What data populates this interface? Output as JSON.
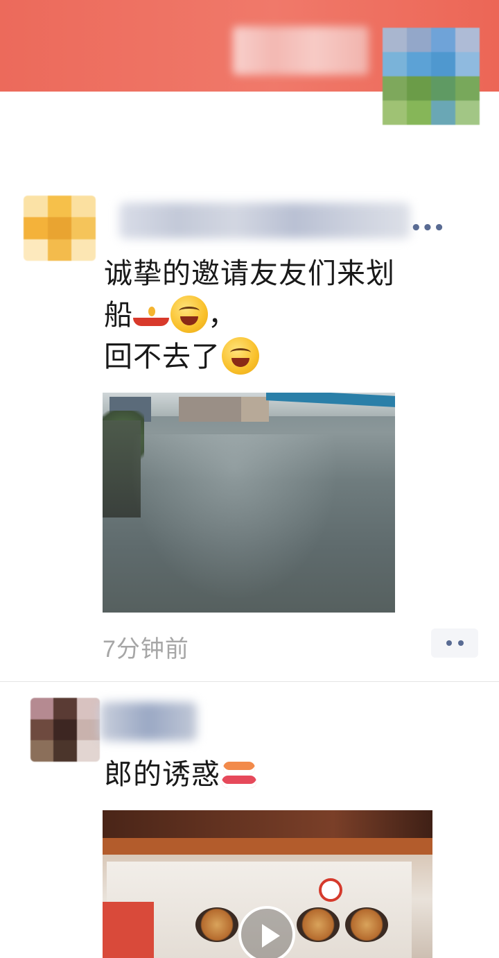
{
  "posts": [
    {
      "text_lines": [
        "诚挚的邀请友友们来划",
        "船",
        "，",
        "回不去了"
      ],
      "timestamp": "7分钟前"
    },
    {
      "text": "郎的诱惑"
    }
  ],
  "icons": {
    "boat": "rowing-boat-emoji",
    "laugh": "face-with-tears-of-joy-emoji",
    "cry": "loudly-crying-face-emoji",
    "sushi": "sushi-emoji",
    "more": "more-dots-icon",
    "play": "play-icon"
  },
  "colors": {
    "cover": "#ec6a5b",
    "link_blue": "#596b93",
    "timestamp_gray": "#a6a6a6"
  }
}
